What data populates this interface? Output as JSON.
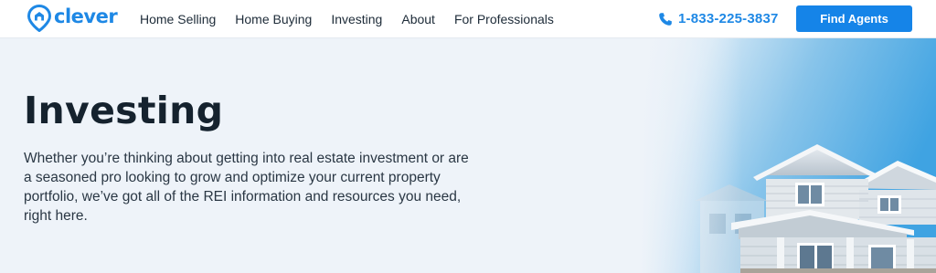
{
  "brand": {
    "name": "clever",
    "color": "#1e88e5"
  },
  "nav": {
    "links": [
      {
        "label": "Home Selling"
      },
      {
        "label": "Home Buying"
      },
      {
        "label": "Investing"
      },
      {
        "label": "About"
      },
      {
        "label": "For Professionals"
      }
    ],
    "phone": "1-833-225-3837",
    "cta_label": "Find Agents"
  },
  "hero": {
    "title": "Investing",
    "description": "Whether you’re thinking about getting into real estate investment or are a seasoned pro looking to grow and optimize your current property portfolio, we’ve got all of the REI information and resources you need, right here.",
    "image": "house-photo"
  },
  "colors": {
    "primary": "#1584e8",
    "hero_background": "#eef3f9",
    "text_dark": "#15222e"
  }
}
